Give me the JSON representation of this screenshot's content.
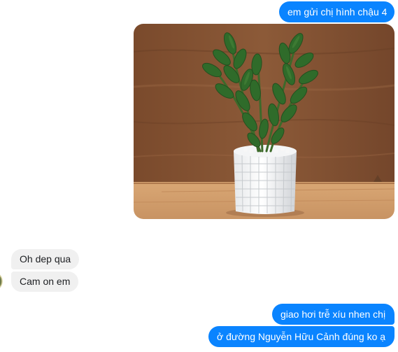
{
  "conversation": {
    "messages": [
      {
        "from": "me",
        "type": "text",
        "text": "em gửi chị hình chậu 4"
      },
      {
        "from": "me",
        "type": "image",
        "image": "zz-plant-in-white-pot-photo"
      },
      {
        "from": "contact",
        "type": "text",
        "text": "Oh dep qua"
      },
      {
        "from": "contact",
        "type": "text",
        "text": "Cam on em"
      },
      {
        "from": "me",
        "type": "text",
        "text": "giao hơi trễ xíu nhen chị"
      },
      {
        "from": "me",
        "type": "text",
        "text": "ở đường Nguyễn Hữu Cảnh đúng ko ạ"
      }
    ]
  },
  "contact": {
    "avatar": "contact-avatar"
  },
  "colors": {
    "outgoing_bubble": "#0a84ff",
    "outgoing_text": "#ffffff",
    "incoming_bubble": "#f0f0f0",
    "incoming_text": "#1c1e21"
  }
}
